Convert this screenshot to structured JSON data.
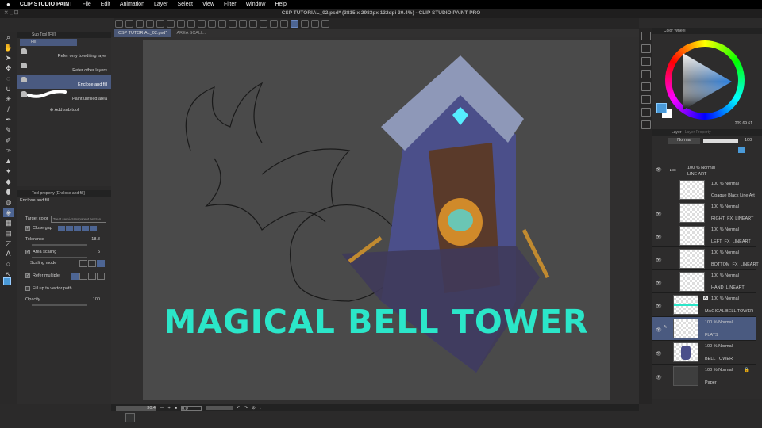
{
  "menu": {
    "apple": "",
    "app": "CLIP STUDIO PAINT",
    "items": [
      "File",
      "Edit",
      "Animation",
      "Layer",
      "Select",
      "View",
      "Filter",
      "Window",
      "Help"
    ]
  },
  "window_title": "CSP TUTORIAL_02.psd* (3815 x 2983px 132dpi 30.4%) - CLIP STUDIO PAINT PRO",
  "tabs": [
    "CSP TUTORIAL_02.psd*",
    "AREA SCALI..."
  ],
  "subtool": {
    "header": "Sub Tool [Fill]",
    "group": "Fill",
    "items": [
      "Refer only to editing layer",
      "Refer other layers",
      "Enclose and fill",
      "Paint unfilled area"
    ],
    "selected": 2,
    "add": "Add sub tool"
  },
  "toolprop": {
    "header": "Tool property [Enclose and fill]",
    "name": "Enclose and fill",
    "target_color_label": "Target color",
    "target_color_value": "Treat semi-transparent as tran...",
    "close_gap": "Close gap",
    "tolerance": "Tolerance",
    "tolerance_value": "18.8",
    "area_scaling": "Area scaling",
    "area_scaling_value": "5",
    "scaling_mode": "Scaling mode",
    "refer_multiple": "Refer multiple",
    "fill_vector": "Fill up to vector path",
    "opacity": "Opacity",
    "opacity_value": "100"
  },
  "canvas": {
    "title": "MAGICAL BELL TOWER"
  },
  "status": {
    "zoom": "30.4",
    "angle": "0.0"
  },
  "color": {
    "tab": "Color Wheel",
    "readout": "209 69 61",
    "main": "#4a9ad8",
    "sub": "#ffffff"
  },
  "layers": {
    "tab": "Layer",
    "tab2": "Layer Property",
    "blend": "Normal",
    "opacity": "100",
    "folder": {
      "mode": "100 % Normal",
      "name": "LINE ART"
    },
    "items": [
      {
        "mode": "100 % Normal",
        "name": "Opaque Black Line Art"
      },
      {
        "mode": "100 % Normal",
        "name": "RIGHT_FX_LINEART"
      },
      {
        "mode": "100 % Normal",
        "name": "LEFT_FX_LINEART"
      },
      {
        "mode": "100 % Normal",
        "name": "BOTTOM_FX_LINEART"
      },
      {
        "mode": "100 % Normal",
        "name": "HAND_LINEART"
      },
      {
        "mode": "100 % Normal",
        "name": "MAGICAL BELL TOWER"
      },
      {
        "mode": "100 % Normal",
        "name": "FLATS"
      },
      {
        "mode": "100 % Normal",
        "name": "BELL TOWER"
      },
      {
        "mode": "100 % Normal",
        "name": "Paper"
      }
    ]
  }
}
